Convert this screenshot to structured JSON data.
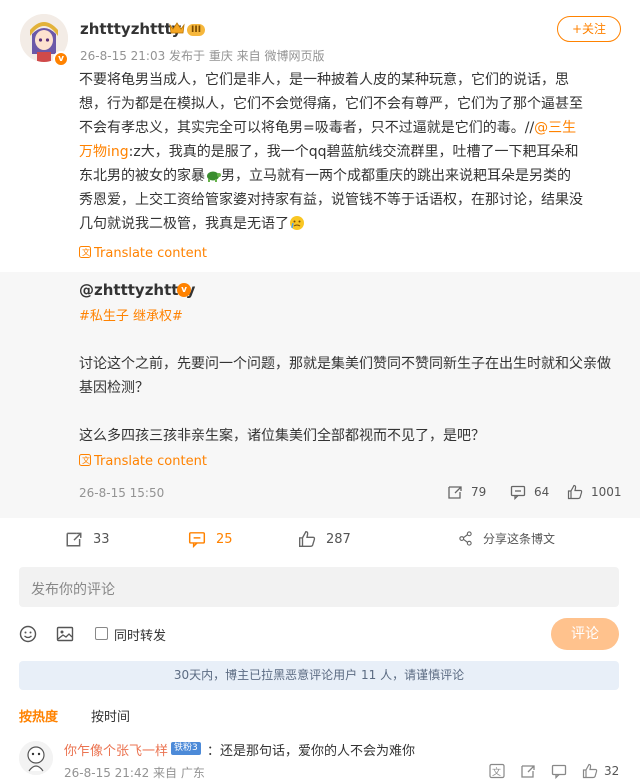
{
  "post": {
    "username": "zhtttyzhttty",
    "level_badge": "III",
    "meta": "26-8-15 21:03  发布于 重庆  来自 微博网页版",
    "follow_label": "+关注",
    "body_lines": [
      "不要将龟男当成人，它们是非人，是一种披着人皮的某种玩意，它们的说话，思",
      "想，行为都是在模拟人，它们不会觉得痛，它们不会有尊严，它们为了那个逼甚至",
      "不会有孝忠义，其实完全可以将龟男=吸毒者，只不过逼就是它们的毒。//"
    ],
    "mention": "@三生",
    "mention_line2": "万物ing",
    "body_after_mention": ":z大，我真的是服了，我一个qq碧蓝航线交流群里，吐槽了一下耙耳朵和",
    "body_line5_before_icon": "东北男的被女的家暴",
    "body_line5_after_icon": "男，立马就有一两个成都重庆的跳出来说耙耳朵是另类的",
    "body_line6": "秀恩爱，上交工资给管家婆对持家有益，说管钱不等于话语权，在那讨论，结果没",
    "body_line7": "几句就说我二极管，我真是无语了",
    "translate_label": "Translate content"
  },
  "repost": {
    "username": "@zhtttyzhttty",
    "tags": "#私生子 继承权#",
    "paragraph1_line1": "讨论这个之前，先要问一个问题，那就是集美们赞同不赞同新生子在出生时就和父亲做",
    "paragraph1_line2": "基因检测？",
    "paragraph2": "这么多四孩三孩非亲生案，诸位集美们全部都视而不见了，是吧？",
    "translate_label": "Translate content",
    "timestamp": "26-8-15 15:50",
    "reposts": "79",
    "comments": "64",
    "likes": "1001"
  },
  "actions": {
    "reposts": "33",
    "comments": "25",
    "likes": "287",
    "share_label": "分享这条博文"
  },
  "composer": {
    "placeholder": "发布你的评论",
    "also_repost_label": "同时转发",
    "submit_label": "评论"
  },
  "notice": "30天内，博主已拉黑恶意评论用户 11 人，请谨慎评论",
  "sort": {
    "hot_label": "按热度",
    "time_label": "按时间"
  },
  "comment": {
    "username": "你乍像个张飞一样",
    "badge": "铁粉3",
    "text": "：还是那句话，爱你的人不会为难你",
    "meta": "26-8-15 21:42 来自 广东",
    "likes": "32"
  },
  "colors": {
    "accent": "#ff8200",
    "repost_bg": "#f7f7f7",
    "notice_bg": "#e8eff8"
  }
}
